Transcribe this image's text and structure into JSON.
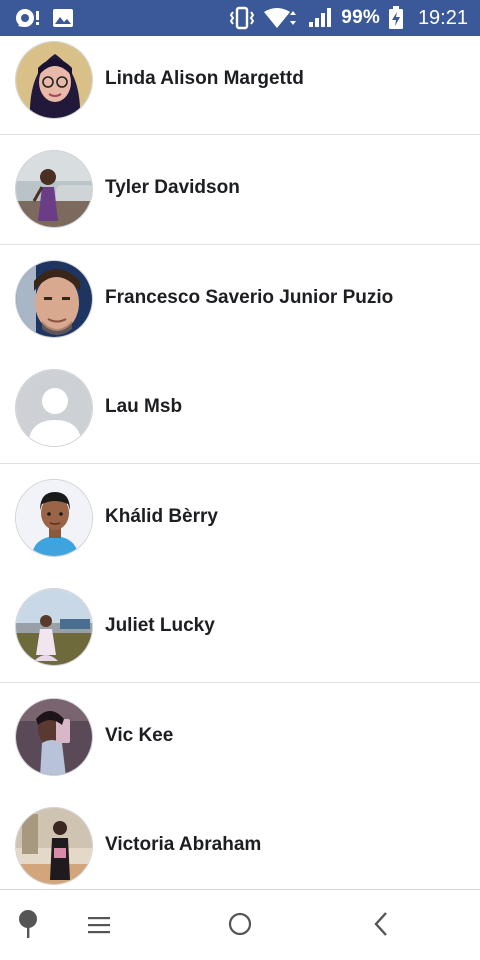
{
  "status_bar": {
    "icons_left": [
      "sync-chat-icon",
      "image-icon"
    ],
    "icons_right": [
      "vibrate-icon",
      "wifi-icon",
      "signal-icon",
      "battery-charging-icon"
    ],
    "battery": "99%",
    "time": "19:21",
    "background": "#3b5998"
  },
  "friends": [
    {
      "name": "Linda Alison Margettd"
    },
    {
      "name": "Tyler Davidson"
    },
    {
      "name": "Francesco Saverio Junior Puzio"
    },
    {
      "name": "Lau Msb"
    },
    {
      "name": "Khálid Bèrry"
    },
    {
      "name": "Juliet Lucky"
    },
    {
      "name": "Vic Kee"
    },
    {
      "name": "Victoria Abraham"
    }
  ],
  "nav_bar": {
    "buttons": [
      "pin-icon",
      "menu-icon",
      "home-icon",
      "back-icon"
    ]
  }
}
